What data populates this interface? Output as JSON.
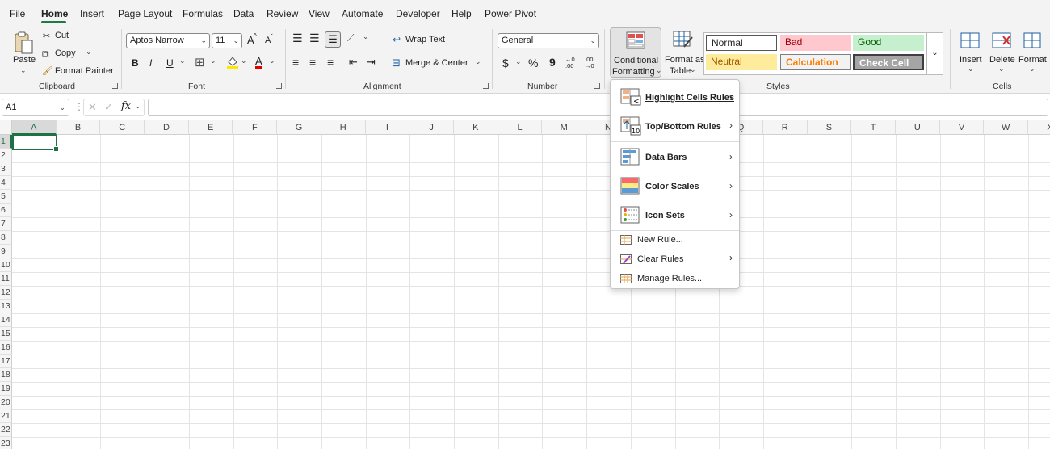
{
  "menu_tabs": [
    "File",
    "Home",
    "Insert",
    "Page Layout",
    "Formulas",
    "Data",
    "Review",
    "View",
    "Automate",
    "Developer",
    "Help",
    "Power Pivot"
  ],
  "clipboard": {
    "paste": "Paste",
    "cut": "Cut",
    "copy": "Copy",
    "format_painter": "Format Painter",
    "group": "Clipboard"
  },
  "font": {
    "name": "Aptos Narrow",
    "size": "11",
    "bold": "B",
    "italic": "I",
    "underline": "U",
    "grow": "A",
    "shrink": "A",
    "color_a": "A",
    "group": "Font"
  },
  "alignment": {
    "wrap_text": "Wrap Text",
    "merge_center": "Merge & Center",
    "group": "Alignment"
  },
  "number": {
    "format": "General",
    "currency": "$",
    "percent": "%",
    "comma": "9",
    "inc_decimal": "←0\n.00",
    "dec_decimal": ".00\n→0",
    "group": "Number"
  },
  "styles": {
    "conditional_1": "Conditional",
    "conditional_2": "Formatting",
    "format_table_1": "Format as",
    "format_table_2": "Table",
    "normal": "Normal",
    "bad": "Bad",
    "good": "Good",
    "neutral": "Neutral",
    "calculation": "Calculation",
    "check_cell": "Check Cell",
    "group": "Styles"
  },
  "cells": {
    "insert": "Insert",
    "delete": "Delete",
    "format": "Format",
    "group": "Cells"
  },
  "formula_bar": {
    "name_box": "A1",
    "fx": "fx",
    "value": ""
  },
  "columns": [
    "A",
    "B",
    "C",
    "D",
    "E",
    "F",
    "G",
    "H",
    "I",
    "J",
    "K",
    "L",
    "M",
    "N",
    "O",
    "P",
    "Q",
    "R",
    "S",
    "T",
    "U",
    "V",
    "W",
    "X"
  ],
  "rows": [
    "1",
    "2",
    "3",
    "4",
    "5",
    "6",
    "7",
    "8",
    "9",
    "10",
    "11",
    "12",
    "13",
    "14",
    "15",
    "16",
    "17",
    "18",
    "19",
    "20",
    "21",
    "22",
    "23"
  ],
  "cf_menu": {
    "highlight": "Highlight Cells Rules",
    "topbottom": "Top/Bottom Rules",
    "databars": "Data Bars",
    "colorscales": "Color Scales",
    "iconsets": "Icon Sets",
    "newrule": "New Rule...",
    "clearrules": "Clear Rules",
    "managerules": "Manage Rules..."
  },
  "colors": {
    "accent": "#1e7145",
    "bad_bg": "#ffc7ce",
    "bad_fg": "#9c0006",
    "good_bg": "#c6efce",
    "good_fg": "#006100",
    "neutral_bg": "#ffeb9c",
    "neutral_fg": "#9c5700",
    "calc_bg": "#f2f2f2",
    "calc_fg": "#fa7d00",
    "check_bg": "#a5a5a5"
  }
}
